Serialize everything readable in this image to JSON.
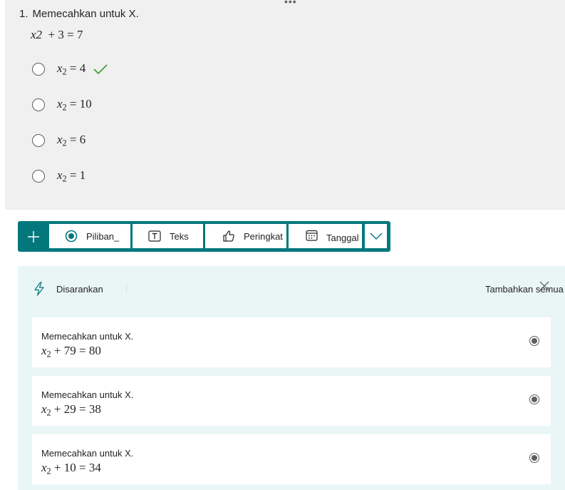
{
  "question": {
    "drag_handle": "•••",
    "number": "1.",
    "title": "Memecahkan untuk X.",
    "equation": {
      "a": "x2",
      "b": "+ 3",
      "c": "= 7"
    },
    "options": [
      {
        "var": "x",
        "sub": "2",
        "rhs": "= 4",
        "correct": true
      },
      {
        "var": "x",
        "sub": "2",
        "rhs": "= 10",
        "correct": false
      },
      {
        "var": "x",
        "sub": "2",
        "rhs": "= 6",
        "correct": false
      },
      {
        "var": "x",
        "sub": "2",
        "rhs": "= 1",
        "correct": false
      }
    ]
  },
  "toolbar": {
    "add_icon": "plus-icon",
    "buttons": [
      {
        "label": "Piliban_",
        "icon": "radio-icon"
      },
      {
        "label": "Teks",
        "icon": "text-box-icon"
      },
      {
        "label": "Peringkat",
        "icon": "thumb-up-icon"
      },
      {
        "label": "Tanggal",
        "icon": "calendar-icon"
      }
    ],
    "more_icon": "chevron-down-icon",
    "color": "#03787c"
  },
  "suggestions": {
    "header_icon": "lightning-icon",
    "header_label": "Disarankan",
    "add_all_label": "Tambahkan semua",
    "close_icon": "close-icon",
    "background": "#eaf6f6",
    "items": [
      {
        "title": "Memecahkan untuk X.",
        "var": "x",
        "sub": "2",
        "rhs": "+ 79 = 80"
      },
      {
        "title": "Memecahkan untuk X.",
        "var": "x",
        "sub": "2",
        "rhs": "+ 29 = 38"
      },
      {
        "title": "Memecahkan untuk X.",
        "var": "x",
        "sub": "2",
        "rhs": "+ 10 = 34"
      }
    ]
  },
  "colors": {
    "accent": "#03787c",
    "check": "#3f9c35",
    "question_bg": "#f0f0f0"
  }
}
